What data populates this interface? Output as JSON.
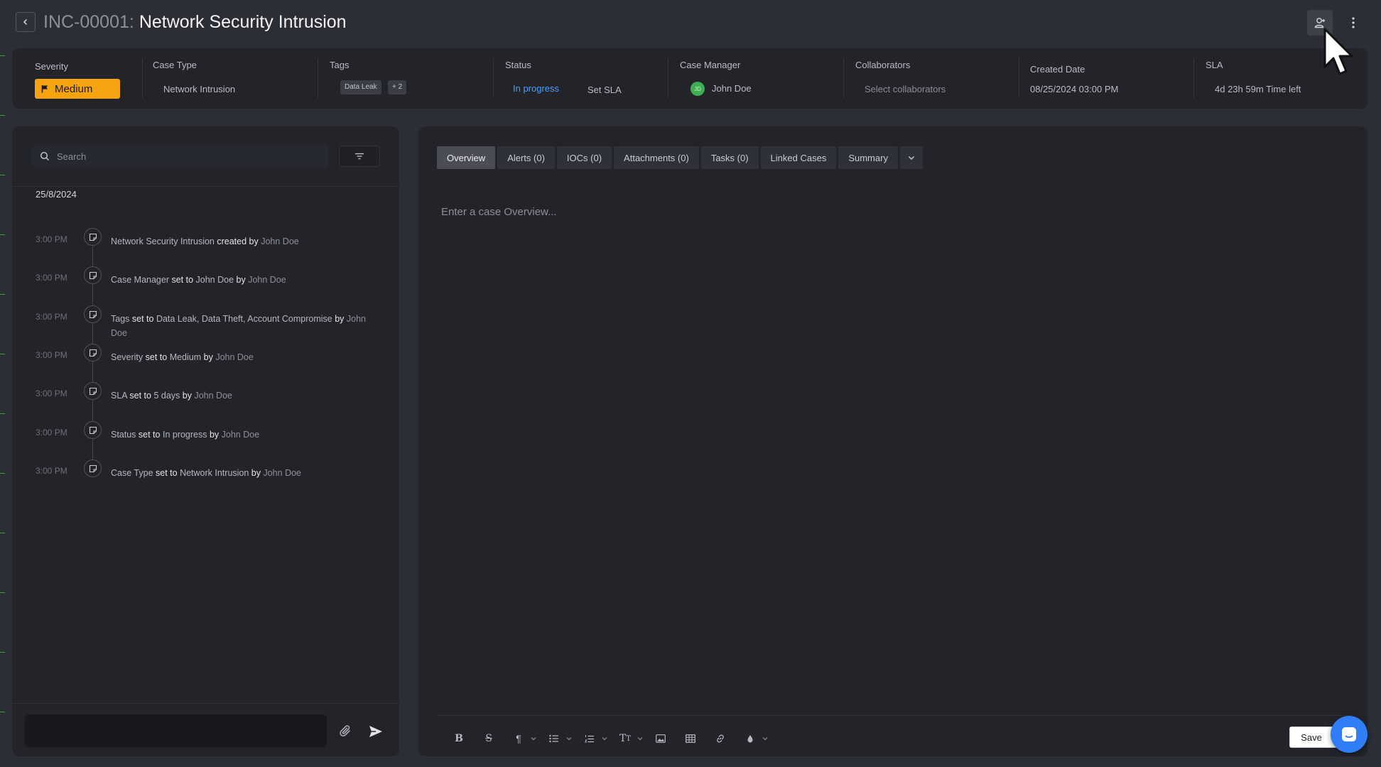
{
  "header": {
    "case_id": "INC-00001:",
    "case_name": "Network Security Intrusion"
  },
  "info": {
    "severity": {
      "label": "Severity",
      "value": "Medium",
      "color": "#f5a30f"
    },
    "case_type": {
      "label": "Case Type",
      "value": "Network Intrusion"
    },
    "tags": {
      "label": "Tags",
      "first": "Data Leak",
      "more": "+ 2"
    },
    "status": {
      "label": "Status",
      "value": "In progress",
      "sla_link": "Set SLA"
    },
    "case_manager": {
      "label": "Case Manager",
      "initials": "JD",
      "name": "John Doe"
    },
    "collaborators": {
      "label": "Collaborators",
      "placeholder": "Select collaborators"
    },
    "created": {
      "label": "Created Date",
      "value": "08/25/2024 03:00 PM"
    },
    "sla": {
      "label": "SLA",
      "value": "4d 23h 59m",
      "suffix": "Time left"
    }
  },
  "activity": {
    "search_placeholder": "Search",
    "date": "25/8/2024",
    "items": [
      {
        "time": "3:00 PM",
        "parts": [
          [
            "Network Security Intrusion",
            "n"
          ],
          [
            " created by ",
            "b"
          ],
          [
            "John Doe",
            "h"
          ]
        ]
      },
      {
        "time": "3:00 PM",
        "parts": [
          [
            "Case Manager",
            "n"
          ],
          [
            " set to ",
            "b"
          ],
          [
            "John Doe",
            "n"
          ],
          [
            " by ",
            "b"
          ],
          [
            "John Doe",
            "h"
          ]
        ]
      },
      {
        "time": "3:00 PM",
        "parts": [
          [
            "Tags",
            "n"
          ],
          [
            " set to ",
            "b"
          ],
          [
            "Data Leak, Data Theft, Account Compromise",
            "n"
          ],
          [
            " by ",
            "b"
          ],
          [
            "John Doe",
            "h"
          ]
        ]
      },
      {
        "time": "3:00 PM",
        "parts": [
          [
            "Severity",
            "n"
          ],
          [
            " set to ",
            "b"
          ],
          [
            "Medium",
            "n"
          ],
          [
            " by ",
            "b"
          ],
          [
            "John Doe",
            "h"
          ]
        ]
      },
      {
        "time": "3:00 PM",
        "parts": [
          [
            "SLA",
            "n"
          ],
          [
            " set to ",
            "b"
          ],
          [
            "5 days",
            "n"
          ],
          [
            " by ",
            "b"
          ],
          [
            "John Doe",
            "h"
          ]
        ]
      },
      {
        "time": "3:00 PM",
        "parts": [
          [
            "Status",
            "n"
          ],
          [
            " set to ",
            "b"
          ],
          [
            "In progress",
            "n"
          ],
          [
            " by ",
            "b"
          ],
          [
            "John Doe",
            "h"
          ]
        ]
      },
      {
        "time": "3:00 PM",
        "parts": [
          [
            "Case Type",
            "n"
          ],
          [
            " set to ",
            "b"
          ],
          [
            "Network Intrusion",
            "n"
          ],
          [
            " by ",
            "b"
          ],
          [
            "John Doe",
            "h"
          ]
        ]
      }
    ]
  },
  "tabs": [
    {
      "label": "Overview",
      "active": true
    },
    {
      "label": "Alerts (0)"
    },
    {
      "label": "IOCs (0)"
    },
    {
      "label": "Attachments (0)"
    },
    {
      "label": "Tasks (0)"
    },
    {
      "label": "Linked Cases"
    },
    {
      "label": "Summary"
    }
  ],
  "editor": {
    "placeholder": "Enter a case Overview...",
    "save_label": "Save"
  },
  "colors": {
    "background": "#2c2e36",
    "panel": "#22242a",
    "accent_blue": "#4a9fff",
    "chat_blue": "#2f7ef7",
    "avatar_green": "#3fae52"
  }
}
